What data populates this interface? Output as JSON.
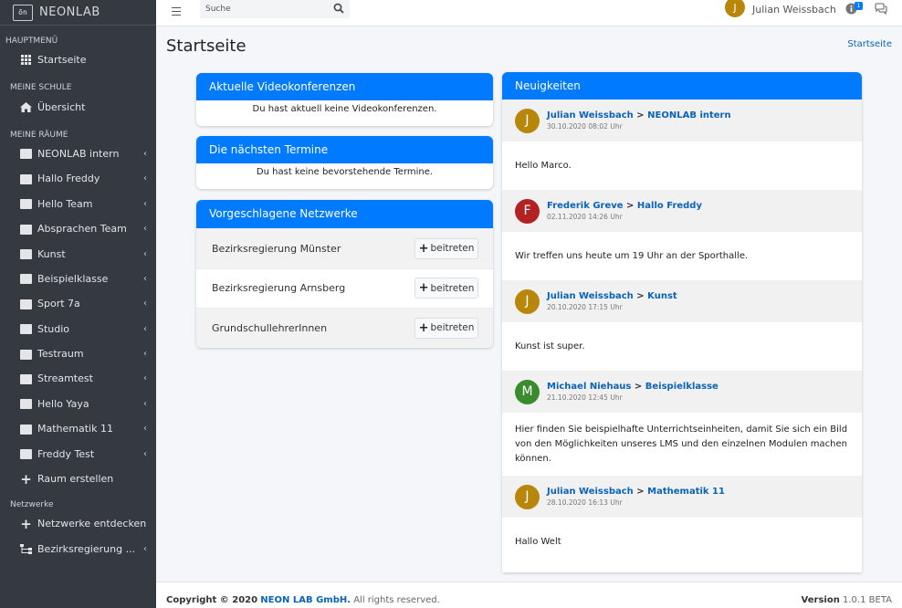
{
  "brand": {
    "name": "NEONLAB",
    "logo_text": "ōn"
  },
  "search": {
    "placeholder": "Suche"
  },
  "user": {
    "name": "Julian Weissbach",
    "initial": "J",
    "notification_count": "1"
  },
  "page": {
    "title": "Startseite",
    "breadcrumb": "Startseite"
  },
  "sidebar": {
    "sections": {
      "main": "HAUPTMENÜ",
      "school": "MEINE SCHULE",
      "rooms": "MEINE RÄUME",
      "networks": "Netzwerke"
    },
    "main_item": "Startseite",
    "school_item": "Übersicht",
    "rooms": [
      "NEONLAB intern",
      "Hallo Freddy",
      "Hello Team",
      "Absprachen Team",
      "Kunst",
      "Beispielklasse",
      "Sport 7a",
      "Studio",
      "Testraum",
      "Streamtest",
      "Hello Yaya",
      "Mathematik 11",
      "Freddy Test"
    ],
    "create_room": "Raum erstellen",
    "discover_networks": "Netzwerke entdecken",
    "network_item": "Bezirksregierung ..."
  },
  "video": {
    "title": "Aktuelle Videokonferenzen",
    "empty": "Du hast aktuell keine Videokonferenzen."
  },
  "appointments": {
    "title": "Die nächsten Termine",
    "empty": "Du hast keine bevorstehende Termine."
  },
  "networks": {
    "title": "Vorgeschlagene Netzwerke",
    "join_label": "beitreten",
    "items": [
      "Bezirksregierung Münster",
      "Bezirksregierung Arnsberg",
      "GrundschullehrerInnen"
    ]
  },
  "news": {
    "title": "Neuigkeiten",
    "separator": ">",
    "items": [
      {
        "initial": "J",
        "color": "#b8860b",
        "author": "Julian Weissbach",
        "room": "NEONLAB intern",
        "date": "30.10.2020 08:02 Uhr",
        "text": "Hello Marco."
      },
      {
        "initial": "F",
        "color": "#b22222",
        "author": "Frederik Greve",
        "room": "Hallo Freddy",
        "date": "02.11.2020 14:26 Uhr",
        "text": "Wir treffen uns heute um 19 Uhr an der Sporthalle."
      },
      {
        "initial": "J",
        "color": "#b8860b",
        "author": "Julian Weissbach",
        "room": "Kunst",
        "date": "20.10.2020 17:15 Uhr",
        "text": "Kunst ist super."
      },
      {
        "initial": "M",
        "color": "#3a8a2e",
        "author": "Michael Niehaus",
        "room": "Beispielklasse",
        "date": "21.10.2020 12:45 Uhr",
        "text": "Hier finden Sie beispielhafte Unterrichtseinheiten, damit Sie sich ein Bild von den Möglichkeiten unseres LMS und den einzelnen Modulen machen können."
      },
      {
        "initial": "J",
        "color": "#b8860b",
        "author": "Julian Weissbach",
        "room": "Mathematik 11",
        "date": "28.10.2020 16:13 Uhr",
        "text": "Hallo Welt"
      }
    ]
  },
  "footer": {
    "copyright": "Copyright © 2020",
    "company": "NEON LAB GmbH.",
    "rights": "All rights reserved.",
    "version_label": "Version",
    "version": "1.0.1 BETA"
  },
  "colors": {
    "primary": "#007bff",
    "sidebar": "#343a40",
    "link": "#0a63b8"
  }
}
